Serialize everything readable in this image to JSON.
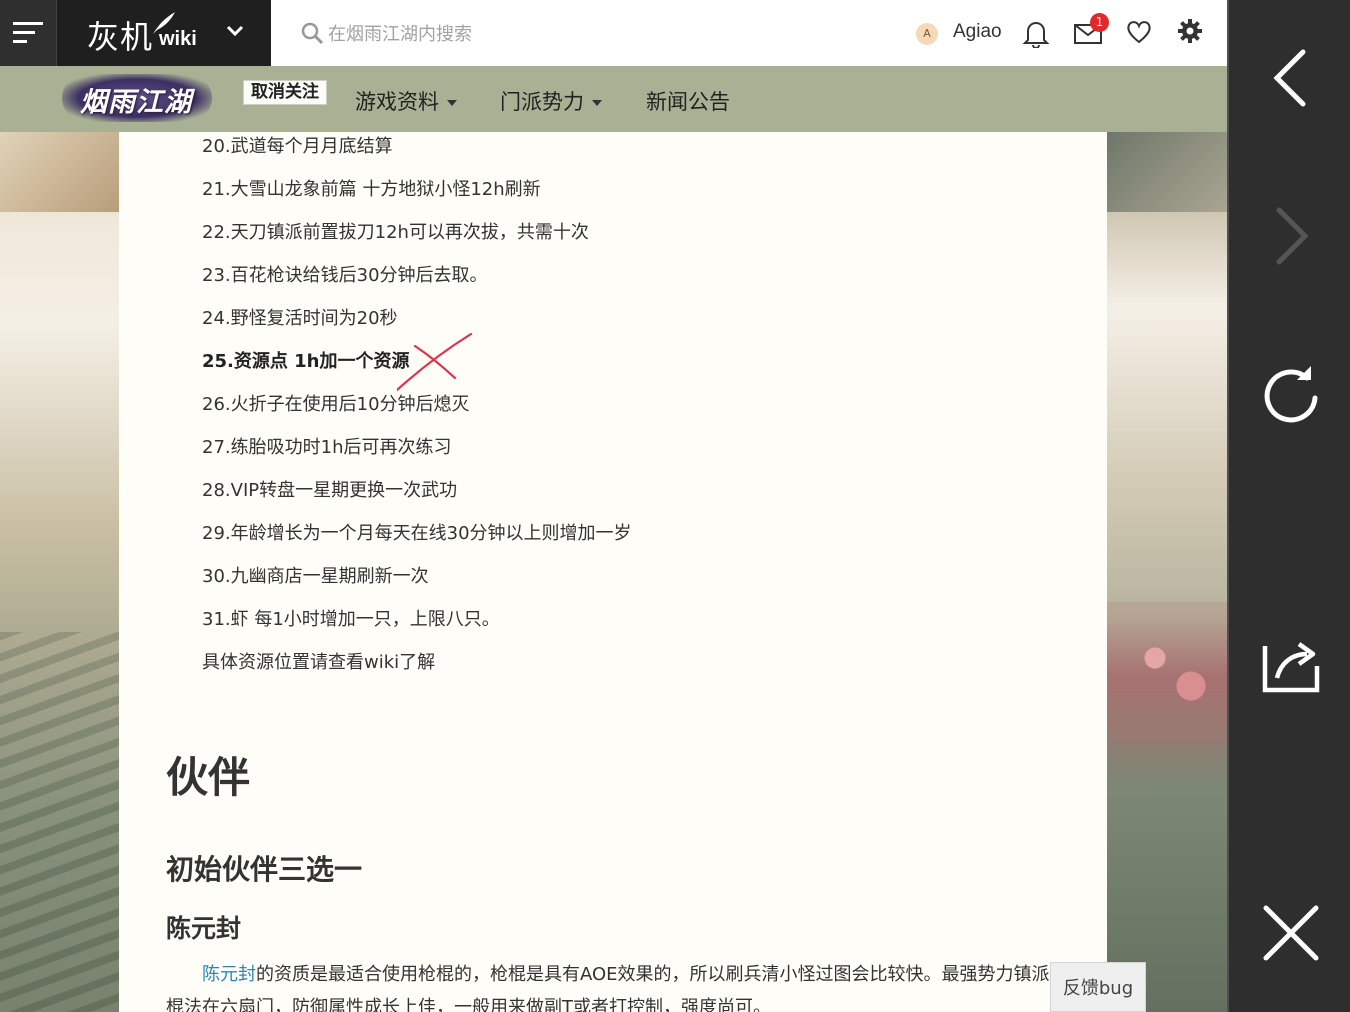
{
  "header": {
    "site_logo_text": "灰机",
    "site_logo_suffix": "wiki",
    "search_placeholder": "在烟雨江湖内搜索",
    "user_initial": "A",
    "username": "Agiao",
    "mail_count": "1"
  },
  "wiki_nav": {
    "logo_text": "烟雨江湖",
    "unfollow_label": "取消关注",
    "items": [
      {
        "label": "游戏资料",
        "has_dropdown": true
      },
      {
        "label": "门派势力",
        "has_dropdown": true
      },
      {
        "label": "新闻公告",
        "has_dropdown": false
      }
    ]
  },
  "content": {
    "list": [
      {
        "text": "20.武道每个月月底结算",
        "bold": false
      },
      {
        "text": "21.大雪山龙象前篇 十方地狱小怪12h刷新",
        "bold": false
      },
      {
        "text": "22.天刀镇派前置拔刀12h可以再次拔，共需十次",
        "bold": false
      },
      {
        "text": "23.百花枪诀给钱后30分钟后去取。",
        "bold": false
      },
      {
        "text": "24.野怪复活时间为20秒",
        "bold": false
      },
      {
        "text": "25.资源点 1h加一个资源",
        "bold": true
      },
      {
        "text": "26.火折子在使用后10分钟后熄灭",
        "bold": false
      },
      {
        "text": "27.练胎吸功时1h后可再次练习",
        "bold": false
      },
      {
        "text": "28.VIP转盘一星期更换一次武功",
        "bold": false
      },
      {
        "text": "29.年龄增长为一个月每天在线30分钟以上则增加一岁",
        "bold": false
      },
      {
        "text": "30.九幽商店一星期刷新一次",
        "bold": false
      },
      {
        "text": "31.虾 每1小时增加一只，上限八只。",
        "bold": false
      },
      {
        "text": "具体资源位置请查看wiki了解",
        "bold": false
      }
    ],
    "heading_partner": "伙伴",
    "heading_initial": "初始伙伴三选一",
    "heading_character": "陈元封",
    "para_link": "陈元封",
    "para_text": "的资质是最适合使用枪棍的，枪棍是具有AOE效果的，所以刷兵清小怪过图会比较快。最强势力镇派棍法在六扇门，防御属性成长上佳，一般用来做副T或者打控制，强度尚可。"
  },
  "feedback_label": "反馈bug",
  "colors": {
    "navbar_bg": "#a9b195",
    "link": "#2a87b8",
    "annotation_red": "#e0304a",
    "side_panel_bg": "#2e2e2e"
  }
}
